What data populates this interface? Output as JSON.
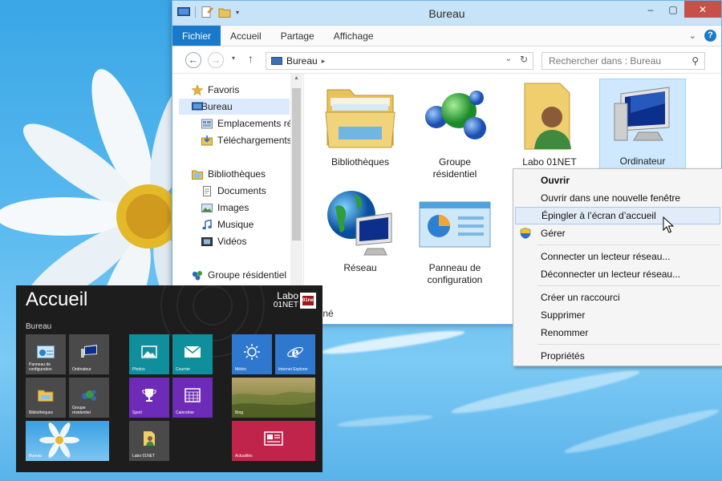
{
  "colors": {
    "accent": "#1979ca",
    "close": "#c7504a",
    "tile_teal": "#0f8f9b",
    "tile_purple": "#6d2bb8",
    "tile_blue": "#2f78d0",
    "tile_red": "#c1244a",
    "tile_gray": "#4a4a4a"
  },
  "window": {
    "title": "Bureau"
  },
  "ribbon": {
    "tabs": [
      "Fichier",
      "Accueil",
      "Partage",
      "Affichage"
    ]
  },
  "address": {
    "path": "Bureau",
    "search_placeholder": "Rechercher dans : Bureau"
  },
  "nav": {
    "favorites": "Favoris",
    "fav_items": [
      "Bureau",
      "Emplacements ré",
      "Téléchargements"
    ],
    "libraries": "Bibliothèques",
    "lib_items": [
      "Documents",
      "Images",
      "Musique",
      "Vidéos"
    ],
    "homegroup": "Groupe résidentiel"
  },
  "items": [
    {
      "label": "Bibliothèques",
      "icon": "libraries-folder-icon"
    },
    {
      "label": "Groupe\nrésidentiel",
      "icon": "homegroup-icon"
    },
    {
      "label": "Labo 01NET",
      "icon": "user-folder-icon"
    },
    {
      "label": "Ordinateur",
      "icon": "computer-icon"
    },
    {
      "label": "Réseau",
      "icon": "network-icon"
    },
    {
      "label": "Panneau de\nconfiguration",
      "icon": "control-panel-icon"
    }
  ],
  "status_text": "tionné",
  "context_menu": {
    "group1": [
      "Ouvrir",
      "Ouvrir dans une nouvelle fenêtre",
      "Épingler à l’écran d’accueil",
      "Gérer"
    ],
    "group2": [
      "Connecter un lecteur réseau...",
      "Déconnecter un lecteur réseau..."
    ],
    "group3": [
      "Créer un raccourci",
      "Supprimer",
      "Renommer"
    ],
    "group4": [
      "Propriétés"
    ]
  },
  "start": {
    "title": "Accueil",
    "user_line1": "Labo",
    "user_line2": "01NET",
    "avatar_text": "01net",
    "group": "Bureau",
    "tiles": [
      "Panneau de\nconfiguration",
      "Ordinateur",
      "Bibliothèques",
      "Groupe\nrésidentiel",
      "Bureau",
      "Photos",
      "Courrier",
      "Sport",
      "Calendrier",
      "Labo 01NET",
      "Météo",
      "Internet Explorer",
      "Bing",
      "Actualités"
    ]
  }
}
